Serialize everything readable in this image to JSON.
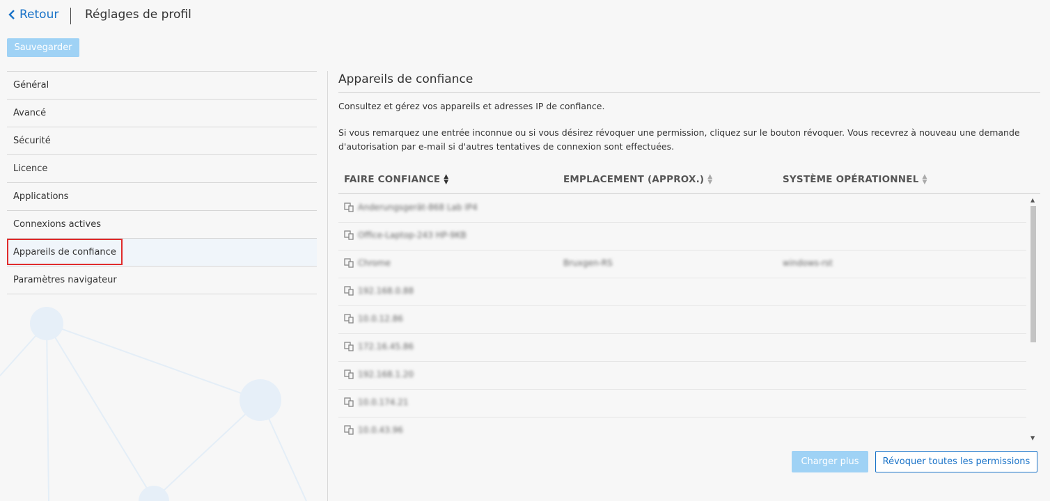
{
  "header": {
    "back_label": "Retour",
    "title": "Réglages de profil"
  },
  "toolbar": {
    "save_label": "Sauvegarder"
  },
  "sidebar": {
    "items": [
      {
        "label": "Général"
      },
      {
        "label": "Avancé"
      },
      {
        "label": "Sécurité"
      },
      {
        "label": "Licence"
      },
      {
        "label": "Applications"
      },
      {
        "label": "Connexions actives"
      },
      {
        "label": "Appareils de confiance"
      },
      {
        "label": "Paramètres navigateur"
      }
    ],
    "active_index": 6
  },
  "main": {
    "title": "Appareils de confiance",
    "description1": "Consultez et gérez vos appareils et adresses IP de confiance.",
    "description2": "Si vous remarquez une entrée inconnue ou si vous désirez révoquer une permission, cliquez sur le bouton révoquer. Vous recevrez à nouveau une demande d'autorisation par e-mail si d'autres tentatives de connexion sont effectuées.",
    "columns": [
      "FAIRE CONFIANCE",
      "EMPLACEMENT (APPROX.)",
      "SYSTÈME OPÉRATIONNEL"
    ],
    "rows": [
      {
        "trust": "Anderungsgerät-868 Lab IP4",
        "location": "",
        "os": ""
      },
      {
        "trust": "Office-Laptop-243 HP-9KB",
        "location": "",
        "os": ""
      },
      {
        "trust": "Chrome",
        "location": "Bruxgen-RS",
        "os": "windows-rst"
      },
      {
        "trust": "192.168.0.88",
        "location": "",
        "os": ""
      },
      {
        "trust": "10.0.12.86",
        "location": "",
        "os": ""
      },
      {
        "trust": "172.16.45.86",
        "location": "",
        "os": ""
      },
      {
        "trust": "192.168.1.20",
        "location": "",
        "os": ""
      },
      {
        "trust": "10.0.174.21",
        "location": "",
        "os": ""
      },
      {
        "trust": "10.0.43.96",
        "location": "",
        "os": ""
      }
    ],
    "load_more_label": "Charger plus",
    "revoke_all_label": "Révoquer toutes les permissions"
  },
  "colors": {
    "accent": "#1a73c8",
    "button_disabled": "#9fd2f5",
    "highlight_box": "#e02b2b",
    "background": "#f7f7f7"
  },
  "icons": {
    "back": "chevron-left-icon",
    "device": "devices-icon",
    "sort": "sort-icon"
  }
}
